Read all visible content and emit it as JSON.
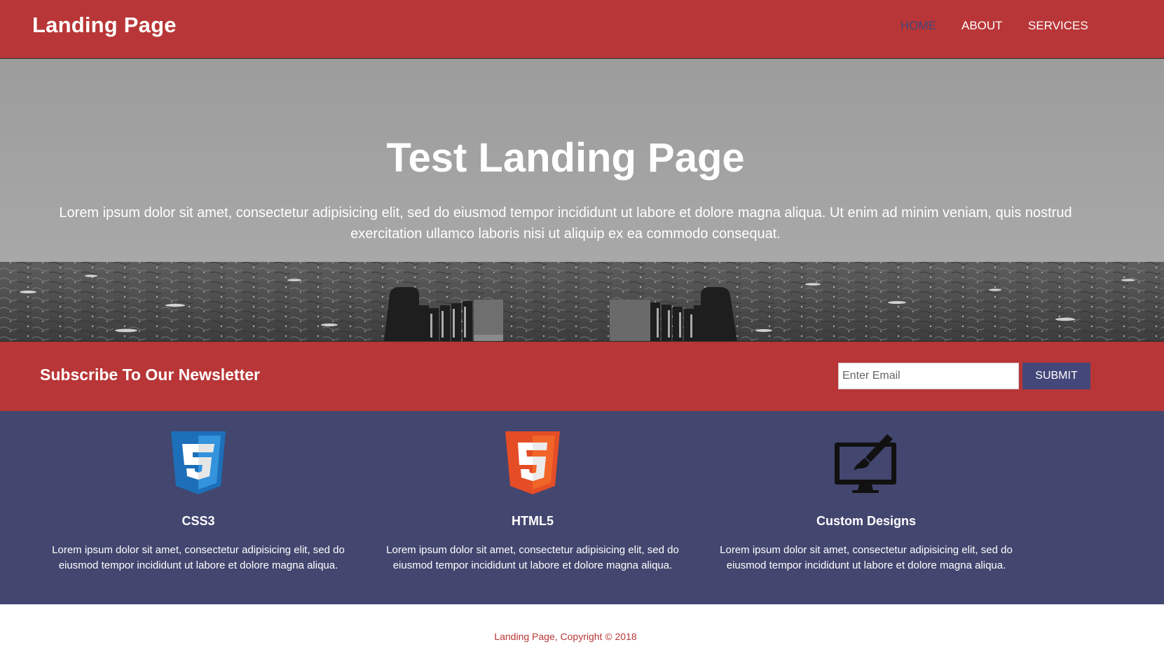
{
  "header": {
    "brand": "Landing Page",
    "nav": [
      {
        "label": "HOME",
        "active": true
      },
      {
        "label": "ABOUT",
        "active": false
      },
      {
        "label": "SERVICES",
        "active": false
      }
    ]
  },
  "hero": {
    "title": "Test Landing Page",
    "text": "Lorem ipsum dolor sit amet, consectetur adipisicing elit, sed do eiusmod tempor incididunt ut labore et dolore magna aliqua. Ut enim ad minim veniam, quis nostrud exercitation ullamco laboris nisi ut aliquip ex ea commodo consequat."
  },
  "newsletter": {
    "title": "Subscribe To Our Newsletter",
    "email_value": "",
    "email_placeholder": "Enter Email",
    "submit_label": "SUBMIT"
  },
  "features": [
    {
      "icon": "css3-icon",
      "title": "CSS3",
      "text": "Lorem ipsum dolor sit amet, consectetur adipisicing elit, sed do eiusmod tempor incididunt ut labore et dolore magna aliqua."
    },
    {
      "icon": "html5-icon",
      "title": "HTML5",
      "text": "Lorem ipsum dolor sit amet, consectetur adipisicing elit, sed do eiusmod tempor incididunt ut labore et dolore magna aliqua."
    },
    {
      "icon": "monitor-brush-icon",
      "title": "Custom Designs",
      "text": "Lorem ipsum dolor sit amet, consectetur adipisicing elit, sed do eiusmod tempor incididunt ut labore et dolore magna aliqua."
    }
  ],
  "footer": {
    "text": "Landing Page, Copyright © 2018"
  },
  "colors": {
    "brand_red": "#b83637",
    "brand_navy": "#43466f",
    "active_nav": "#43477a"
  }
}
